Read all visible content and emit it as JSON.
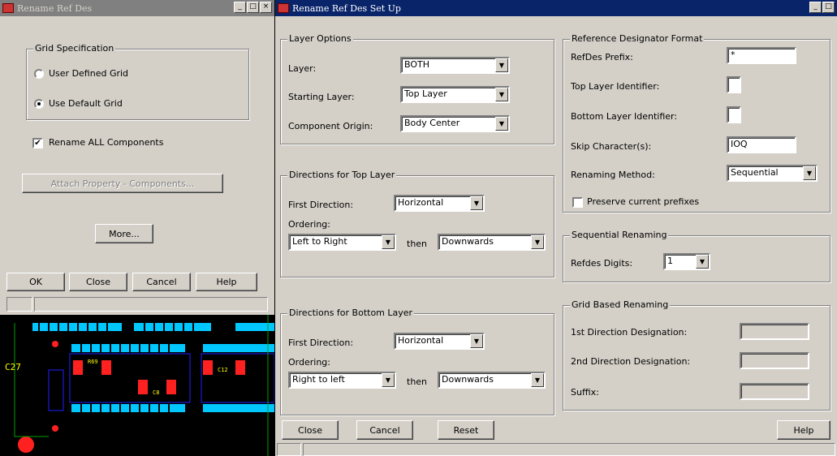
{
  "left_window": {
    "title": "Rename Ref Des",
    "grid_spec": {
      "legend": "Grid Specification",
      "opt_user": "User Defined Grid",
      "opt_default": "Use Default Grid"
    },
    "rename_all": "Rename ALL Components",
    "checked_mark": "✔",
    "attach": "Attach Property - Components...",
    "more": "More...",
    "buttons": {
      "ok": "OK",
      "close": "Close",
      "cancel": "Cancel",
      "help": "Help"
    }
  },
  "pcb": {
    "label": "C27",
    "ref1": "R69",
    "ref2": "C12",
    "ref3": "C8"
  },
  "right_window": {
    "title": "Rename Ref Des Set Up",
    "layer_options": {
      "legend": "Layer Options",
      "layer_label": "Layer:",
      "layer_value": "BOTH",
      "starting_label": "Starting Layer:",
      "starting_value": "Top Layer",
      "origin_label": "Component Origin:",
      "origin_value": "Body Center"
    },
    "top_layer": {
      "legend": "Directions for Top Layer",
      "first_label": "First Direction:",
      "first_value": "Horizontal",
      "ordering_label": "Ordering:",
      "order1": "Left to Right",
      "then": "then",
      "order2": "Downwards"
    },
    "bottom_layer": {
      "legend": "Directions for Bottom Layer",
      "first_label": "First Direction:",
      "first_value": "Horizontal",
      "ordering_label": "Ordering:",
      "order1": "Right to left",
      "then": "then",
      "order2": "Downwards"
    },
    "refdes_format": {
      "legend": "Reference Designator Format",
      "prefix_label": "RefDes Prefix:",
      "prefix_value": "*",
      "top_id_label": "Top Layer Identifier:",
      "bottom_id_label": "Bottom Layer Identifier:",
      "skip_label": "Skip Character(s):",
      "skip_value": "IOQ",
      "method_label": "Renaming Method:",
      "method_value": "Sequential",
      "preserve_label": "Preserve current prefixes"
    },
    "sequential": {
      "legend": "Sequential Renaming",
      "digits_label": "Refdes Digits:",
      "digits_value": "1"
    },
    "grid_based": {
      "legend": "Grid Based Renaming",
      "first_label": "1st Direction Designation:",
      "second_label": "2nd Direction Designation:",
      "suffix_label": "Suffix:"
    },
    "buttons": {
      "close": "Close",
      "cancel": "Cancel",
      "reset": "Reset",
      "help": "Help"
    }
  },
  "icons": {
    "close": "×",
    "minimize": "_",
    "maximize": "□",
    "dropdown": "▼"
  }
}
